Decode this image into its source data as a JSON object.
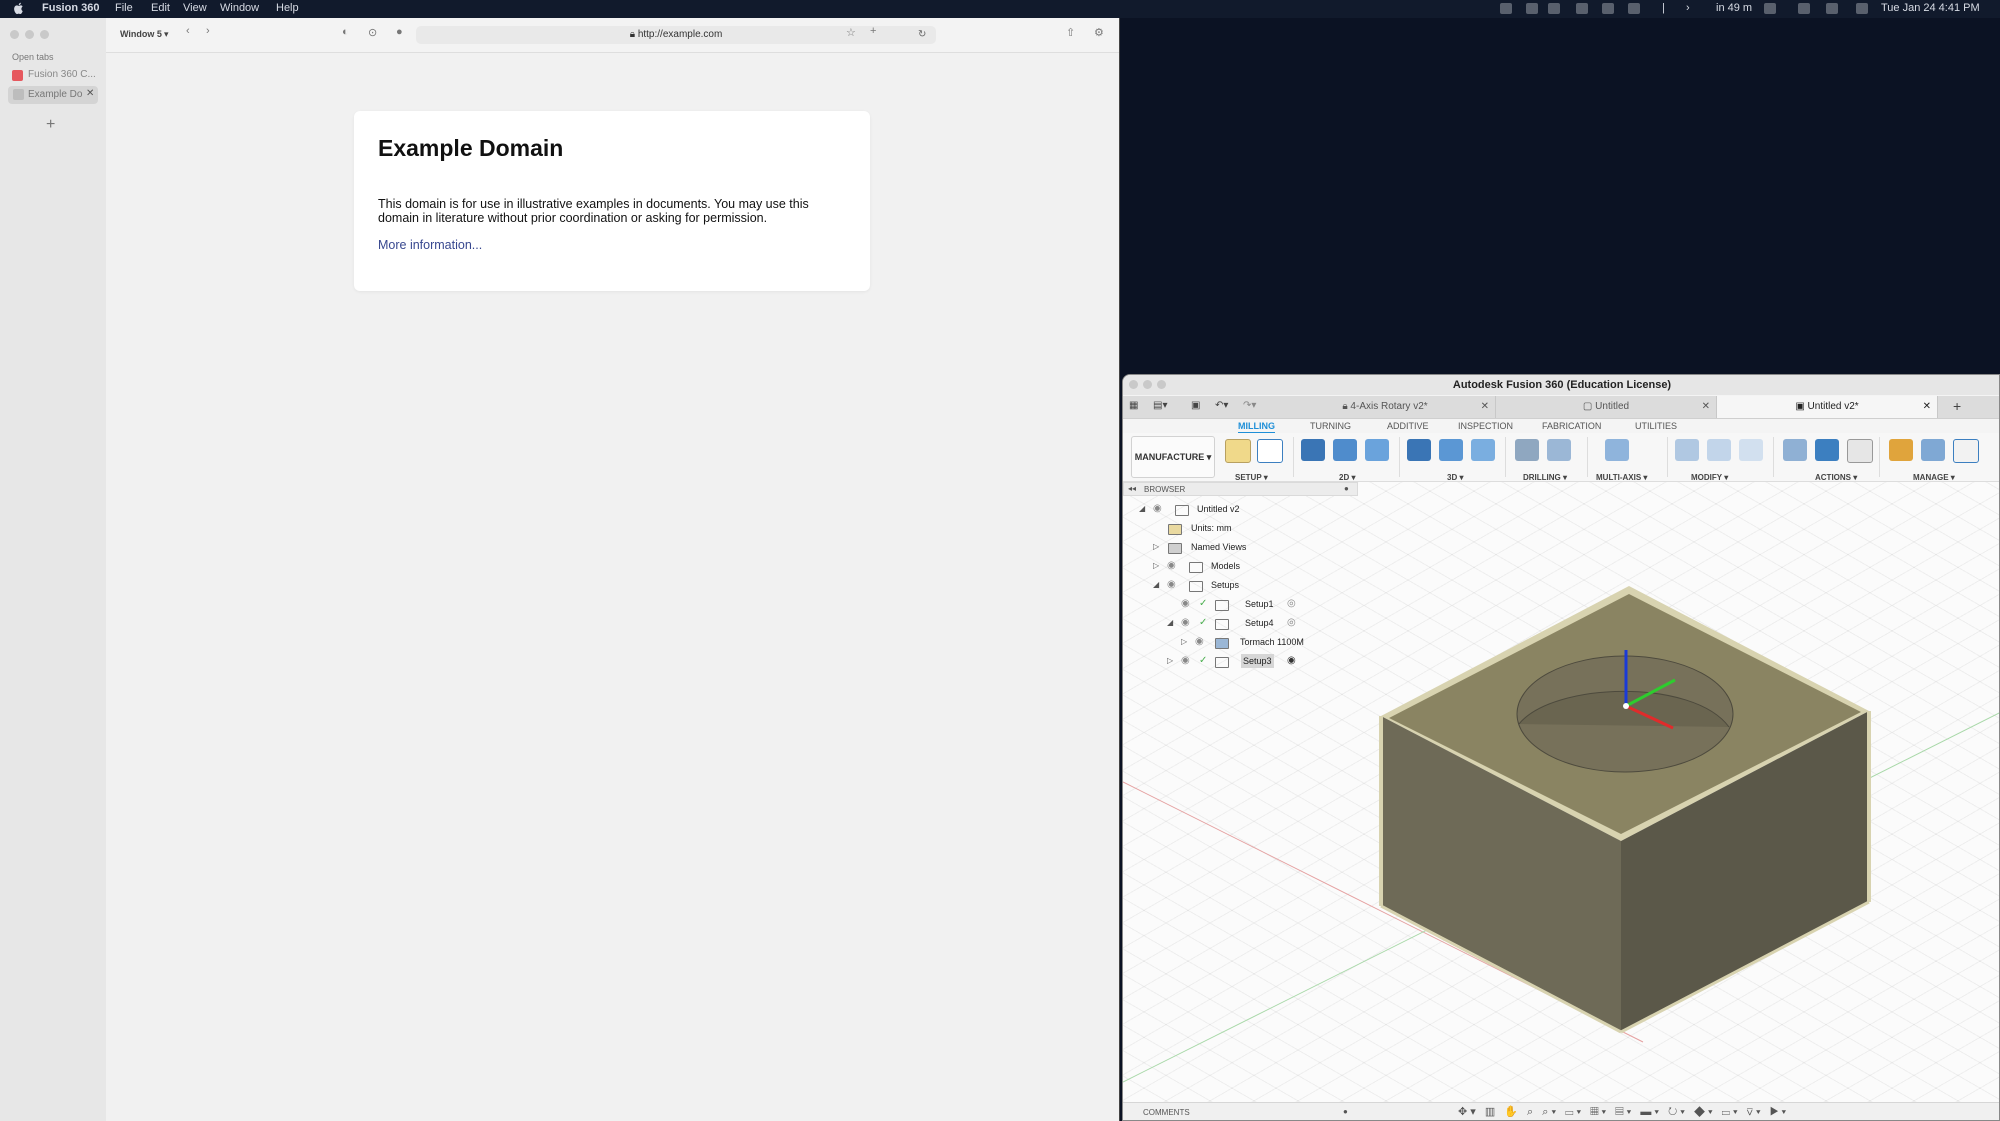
{
  "menubar": {
    "apple": "",
    "app_name": "Fusion 360",
    "items": [
      "File",
      "Edit",
      "View",
      "Window",
      "Help"
    ],
    "status_time": "in 49 m",
    "datetime": "Tue Jan 24  4:41 PM"
  },
  "browser": {
    "sidebar_heading": "Open tabs",
    "tabs": [
      {
        "label": "Fusion 360 C..."
      },
      {
        "label": "Example Do"
      }
    ],
    "add_tab": "+",
    "window_menu": "Window 5",
    "url": "http://example.com",
    "page": {
      "heading": "Example Domain",
      "body": "This domain is for use in illustrative examples in documents. You may use this domain in literature without prior coordination or asking for permission.",
      "link": "More information..."
    }
  },
  "fusion": {
    "title": "Autodesk Fusion 360 (Education License)",
    "doc_tabs": [
      "4-Axis Rotary v2*",
      "Untitled",
      "Untitled v2*"
    ],
    "ribbon_tabs": [
      "MILLING",
      "TURNING",
      "ADDITIVE",
      "INSPECTION",
      "FABRICATION",
      "UTILITIES"
    ],
    "workspace": "MANUFACTURE",
    "groups": [
      "SETUP",
      "2D",
      "3D",
      "DRILLING",
      "MULTI-AXIS",
      "MODIFY",
      "ACTIONS",
      "MANAGE"
    ],
    "browser_title": "BROWSER",
    "tree": [
      {
        "label": "Untitled v2"
      },
      {
        "label": "Units: mm"
      },
      {
        "label": "Named Views"
      },
      {
        "label": "Models"
      },
      {
        "label": "Setups"
      },
      {
        "label": "Setup1"
      },
      {
        "label": "Setup4"
      },
      {
        "label": "Tormach 1100M"
      },
      {
        "label": "Setup3"
      }
    ],
    "comments": "COMMENTS",
    "colors": {
      "accent": "#1e8fd8",
      "model_top": "#8a8462",
      "model_left": "#6f6b58",
      "model_right": "#5a5747"
    }
  }
}
